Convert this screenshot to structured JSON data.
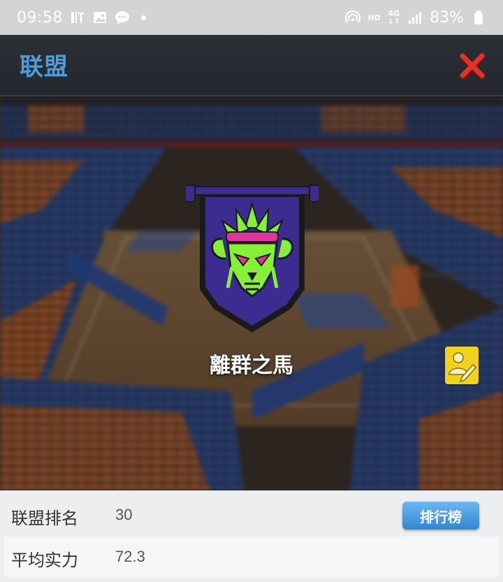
{
  "status_bar": {
    "time": "09:58",
    "left_icons": [
      "tiktok-icon",
      "gallery-icon",
      "message-icon",
      "dot-icon"
    ],
    "network_label_top": "HD",
    "network_label_gen": "4G",
    "battery": "83%"
  },
  "header": {
    "title": "联盟",
    "close_icon": "close-icon"
  },
  "team": {
    "name": "離群之馬",
    "crest_icon": "bull-skull-crest-icon",
    "edit_icon": "edit-profile-icon"
  },
  "info": {
    "rows": [
      {
        "label": "联盟排名",
        "value": "30",
        "button_label": "排行榜"
      },
      {
        "label": "平均实力",
        "value": "72.3"
      }
    ]
  },
  "colors": {
    "title_blue": "#4f9bd8",
    "close_red": "#e0342a",
    "edit_yellow": "#f0d21e",
    "rank_button_blue": "#2f86d2",
    "crest_purple": "#3d2c8f",
    "crest_green": "#86f036",
    "crest_pink": "#e2329c"
  }
}
